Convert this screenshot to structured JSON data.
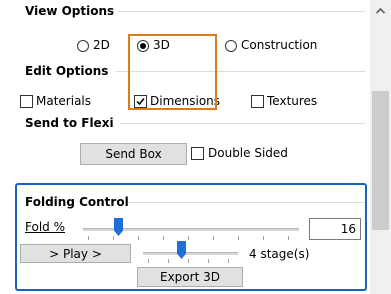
{
  "view_options": {
    "title": "View Options",
    "radio_2d": "2D",
    "radio_3d": "3D",
    "radio_construction": "Construction",
    "selected": "3D"
  },
  "edit_options": {
    "title": "Edit Options",
    "materials": "Materials",
    "dimensions": "Dimensions",
    "textures": "Textures",
    "dimensions_checked": true
  },
  "send_to_flexi": {
    "title": "Send to Flexi",
    "send_box": "Send Box",
    "double_sided": "Double Sided"
  },
  "folding_control": {
    "title": "Folding Control",
    "fold_label": "Fold %",
    "fold_value": "16",
    "play_button": "> Play >",
    "stages_text": "4 stage(s)",
    "export_button": "Export 3D",
    "fold_slider_level": 0.16,
    "stage_slider_level": 0.4
  },
  "colors": {
    "highlight_orange": "#e07a1f",
    "highlight_blue": "#1565c0",
    "slider_thumb": "#1e6fd9"
  },
  "icons": [
    "scroll-up-arrow-icon",
    "check-icon"
  ]
}
